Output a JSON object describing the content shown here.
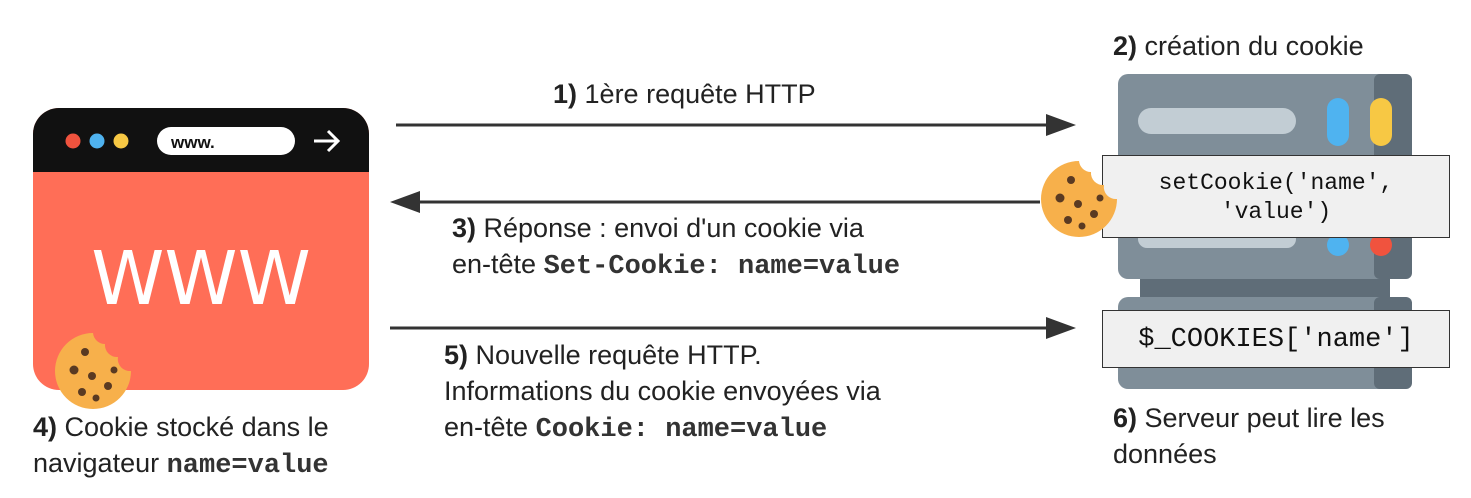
{
  "browser": {
    "url_text": "www.",
    "big_text": "WWW",
    "dot_colors": [
      "#f0533e",
      "#4fb3f0",
      "#f7c844"
    ],
    "accent": "#ff6e57"
  },
  "server": {
    "body_color": "#7f8e99",
    "indicator_colors": [
      "#4fb3f0",
      "#f7c844",
      "#f0533e"
    ]
  },
  "steps": {
    "s1": {
      "num": "1)",
      "text": "1ère requête HTTP"
    },
    "s2": {
      "num": "2)",
      "text": "création du cookie"
    },
    "s3": {
      "num": "3)",
      "line1": "Réponse : envoi d'un cookie via",
      "line2_pre": "en-tête",
      "line2_code": "Set-Cookie: name=value"
    },
    "s4": {
      "num": "4)",
      "line1": "Cookie stocké dans le",
      "line2_pre": "navigateur",
      "line2_code": "name=value"
    },
    "s5": {
      "num": "5)",
      "line1": "Nouvelle requête HTTP.",
      "line2": "Informations du cookie envoyées via",
      "line3_pre": "en-tête",
      "line3_code": "Cookie: name=value"
    },
    "s6": {
      "num": "6)",
      "line1": "Serveur peut lire les",
      "line2": "données"
    }
  },
  "code": {
    "set_cookie_line1": "setCookie('name',",
    "set_cookie_line2": "'value')",
    "read_cookie": "$_COOKIES['name']"
  }
}
